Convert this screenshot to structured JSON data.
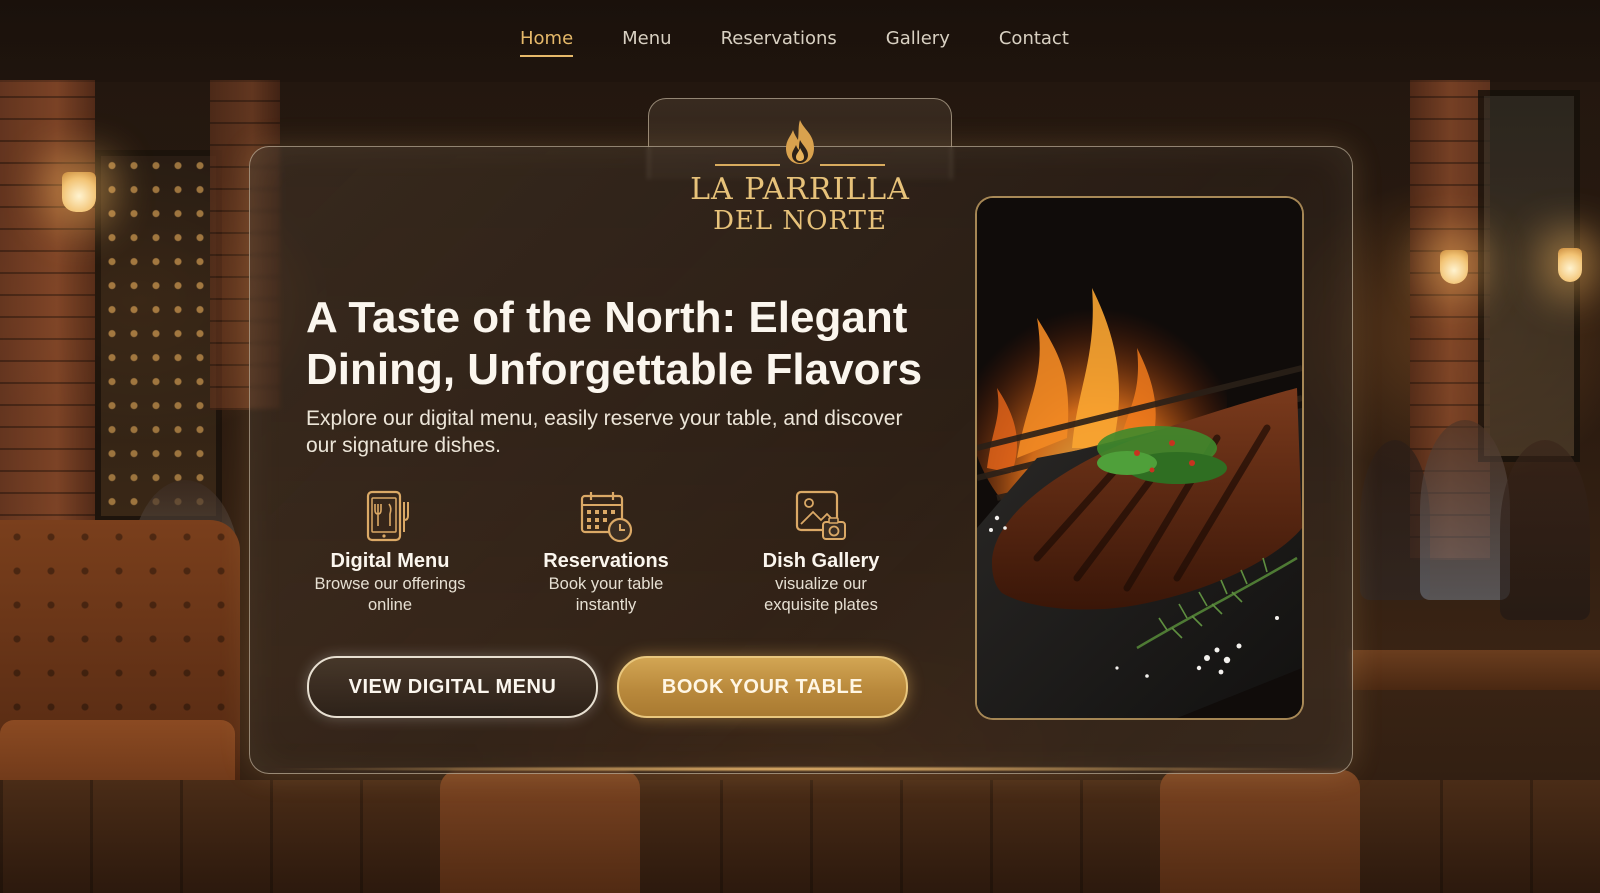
{
  "nav": {
    "items": [
      {
        "label": "Home",
        "active": true
      },
      {
        "label": "Menu",
        "active": false
      },
      {
        "label": "Reservations",
        "active": false
      },
      {
        "label": "Gallery",
        "active": false
      },
      {
        "label": "Contact",
        "active": false
      }
    ]
  },
  "brand": {
    "line1": "LA PARRILLA",
    "line2": "DEL NORTE",
    "icon": "flame-icon"
  },
  "hero": {
    "headline_line1": "A Taste of the North: Elegant",
    "headline_line2": "Dining, Unforgettable Flavors",
    "subtitle": "Explore our digital menu, easily reserve your table, and discover our signature dishes."
  },
  "features": [
    {
      "icon": "digital-menu-icon",
      "title": "Digital Menu",
      "desc_line1": "Browse our offerings",
      "desc_line2": "online"
    },
    {
      "icon": "calendar-clock-icon",
      "title": "Reservations",
      "desc_line1": "Book your table",
      "desc_line2": "instantly"
    },
    {
      "icon": "photo-camera-icon",
      "title": "Dish Gallery",
      "desc_line1": "visualize our",
      "desc_line2": "exquisite plates"
    }
  ],
  "buttons": {
    "menu_label": "VIEW DIGITAL MENU",
    "book_label": "BOOK YOUR TABLE"
  },
  "colors": {
    "accent_gold": "#d2a553",
    "nav_active": "#e6b96a",
    "text_light": "#fbf6ee"
  }
}
